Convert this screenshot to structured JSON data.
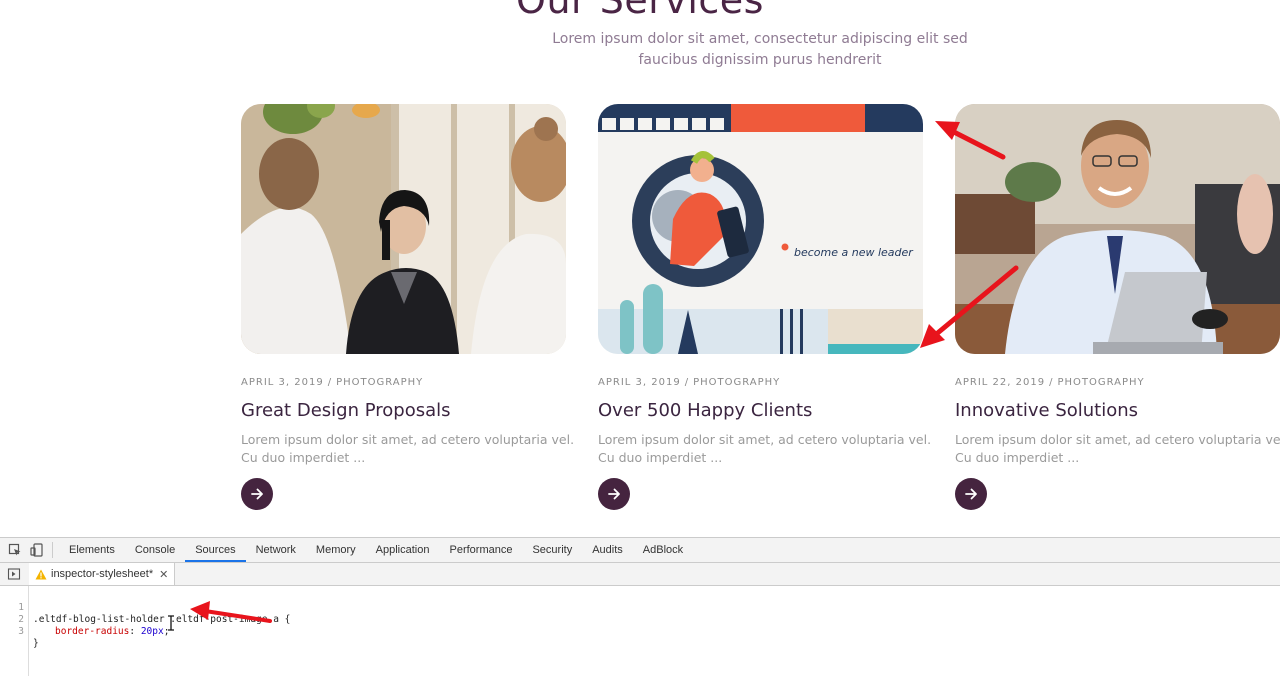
{
  "section": {
    "title": "Our Services",
    "subtitle": "Lorem ipsum dolor sit amet, consectetur adipiscing elit sed faucibus dignissim purus hendrerit"
  },
  "posts": [
    {
      "date": "APRIL 3, 2019",
      "separator": "/",
      "category": "PHOTOGRAPHY",
      "title": "Great Design Proposals",
      "excerpt": "Lorem ipsum dolor sit amet, ad cetero voluptaria vel. Cu duo imperdiet ...",
      "image": "office-meeting-photo"
    },
    {
      "date": "APRIL 3, 2019",
      "separator": "/",
      "category": "PHOTOGRAPHY",
      "title": "Over 500 Happy Clients",
      "excerpt": "Lorem ipsum dolor sit amet, ad cetero voluptaria vel. Cu duo imperdiet ...",
      "image": "become-a-new-leader-illustration",
      "image_text": "become a new leader"
    },
    {
      "date": "APRIL 22, 2019",
      "separator": "/",
      "category": "PHOTOGRAPHY",
      "title": "Innovative Solutions",
      "excerpt": "Lorem ipsum dolor sit amet, ad cetero voluptaria vel. Cu duo imperdiet ...",
      "image": "smiling-businessman-laptop-photo"
    }
  ],
  "devtools": {
    "tabs": [
      "Elements",
      "Console",
      "Sources",
      "Network",
      "Memory",
      "Application",
      "Performance",
      "Security",
      "Audits",
      "AdBlock"
    ],
    "active_tab": "Sources",
    "file_tab": "inspector-stylesheet*",
    "code": {
      "line_numbers": [
        "1",
        "2",
        "3"
      ],
      "selector": ".eltdf-blog-list-holder .eltdf-post-image a {",
      "property": "border-radius",
      "value": "20px",
      "closing": "}"
    }
  },
  "colors": {
    "accent": "#45243f",
    "title": "#4a2545",
    "annotation": "#e8141c",
    "devtools_active": "#1a73e8"
  },
  "icons": [
    "arrow-right-icon",
    "inspect-element-icon",
    "device-toolbar-icon",
    "toggle-navigator-icon",
    "warning-icon",
    "close-icon",
    "text-cursor-icon"
  ]
}
